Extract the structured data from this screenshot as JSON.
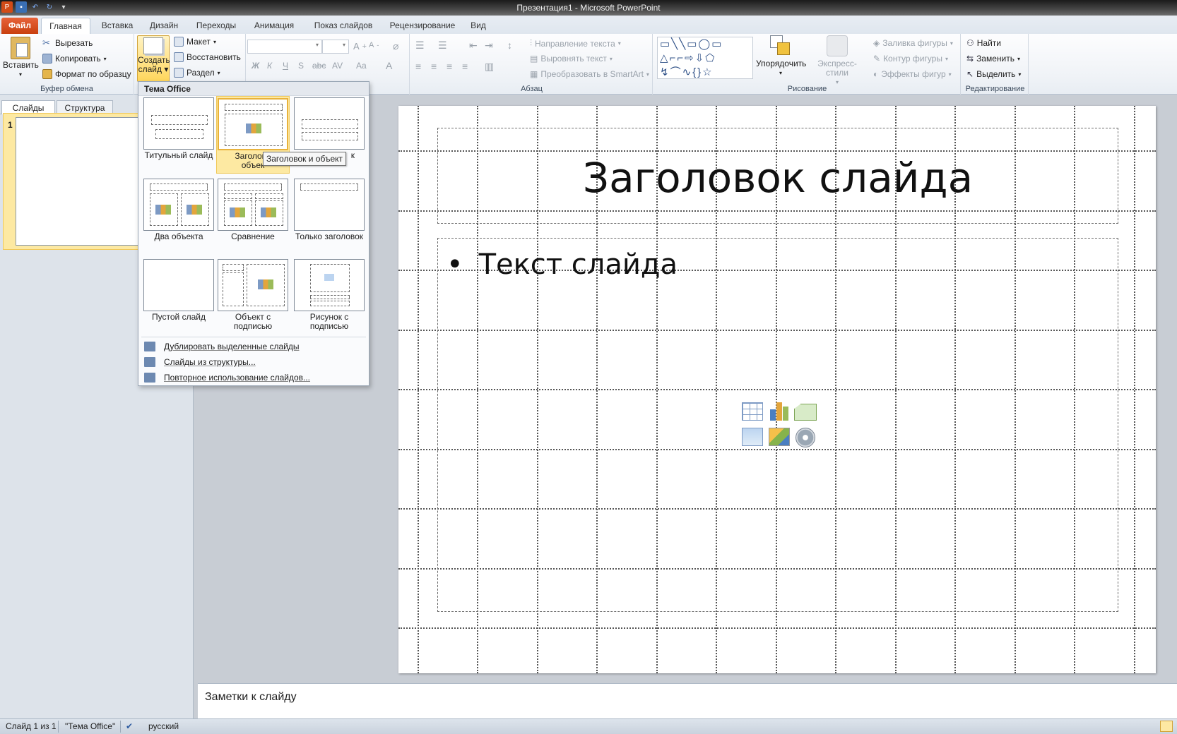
{
  "window": {
    "title": "Презентация1  -  Microsoft PowerPoint"
  },
  "qat": {
    "app_icon": "powerpoint-icon",
    "save_icon": "save-icon",
    "undo_icon": "undo-icon",
    "redo_icon": "redo-icon"
  },
  "tabs": [
    "Файл",
    "Главная",
    "Вставка",
    "Дизайн",
    "Переходы",
    "Анимация",
    "Показ слайдов",
    "Рецензирование",
    "Вид"
  ],
  "ribbon": {
    "clipboard": {
      "paste": "Вставить",
      "cut": "Вырезать",
      "copy": "Копировать",
      "format_painter": "Формат по образцу",
      "label": "Буфер обмена"
    },
    "slides": {
      "new_slide_line1": "Создать",
      "new_slide_line2": "слайд",
      "layout": "Макет",
      "reset": "Восстановить",
      "section": "Раздел"
    },
    "font": {
      "bold": "Ж",
      "italic": "К",
      "underline": "Ч",
      "strike": "S",
      "abc": "abc",
      "spacing": "AV",
      "case": "Aa",
      "color": "A"
    },
    "paragraph": {
      "text_direction": "Направление текста",
      "align_text": "Выровнять текст",
      "smartart": "Преобразовать в SmartArt",
      "label": "Абзац"
    },
    "drawing": {
      "arrange": "Упорядочить",
      "quick_styles": "Экспресс-стили",
      "shape_fill": "Заливка фигуры",
      "shape_outline": "Контур фигуры",
      "shape_effects": "Эффекты фигур",
      "label": "Рисование"
    },
    "editing": {
      "find": "Найти",
      "replace": "Заменить",
      "select": "Выделить",
      "label": "Редактирование"
    }
  },
  "left_panel": {
    "tab_slides": "Слайды",
    "tab_outline": "Структура",
    "slide_number": "1"
  },
  "dropdown": {
    "header": "Тема Office",
    "layouts": [
      {
        "label": "Титульный слайд"
      },
      {
        "label": "Заголовок и объект"
      },
      {
        "label": "Заголовок раздела"
      },
      {
        "label": "Два объекта"
      },
      {
        "label": "Сравнение"
      },
      {
        "label": "Только заголовок"
      },
      {
        "label": "Пустой слайд"
      },
      {
        "label": "Объект с подписью"
      },
      {
        "label": "Рисунок с подписью"
      }
    ],
    "layout_labels_visible": {
      "l0": "Титульный слайд",
      "l1a": "Заголово",
      "l1b": "объек",
      "l2": "к",
      "l3": "Два объекта",
      "l4": "Сравнение",
      "l5": "Только заголовок",
      "l6": "Пустой слайд",
      "l7a": "Объект с",
      "l7b": "подписью",
      "l8a": "Рисунок с",
      "l8b": "подписью"
    },
    "items": [
      "Дублировать выделенные слайды",
      "Слайды из структуры...",
      "Повторное использование слайдов..."
    ],
    "tooltip": "Заголовок и объект"
  },
  "slide": {
    "title": "Заголовок слайда",
    "bullet": "Текст слайда",
    "bullet_char": "•"
  },
  "notes": {
    "placeholder": "Заметки к слайду"
  },
  "status": {
    "slide_counter": "Слайд 1 из 1",
    "theme": "\"Тема Office\"",
    "language": "русский"
  },
  "colors": {
    "accent_file_tab": "#d24b17",
    "selection": "#fde9a2",
    "ribbon_bg": "#f0f3f7"
  }
}
